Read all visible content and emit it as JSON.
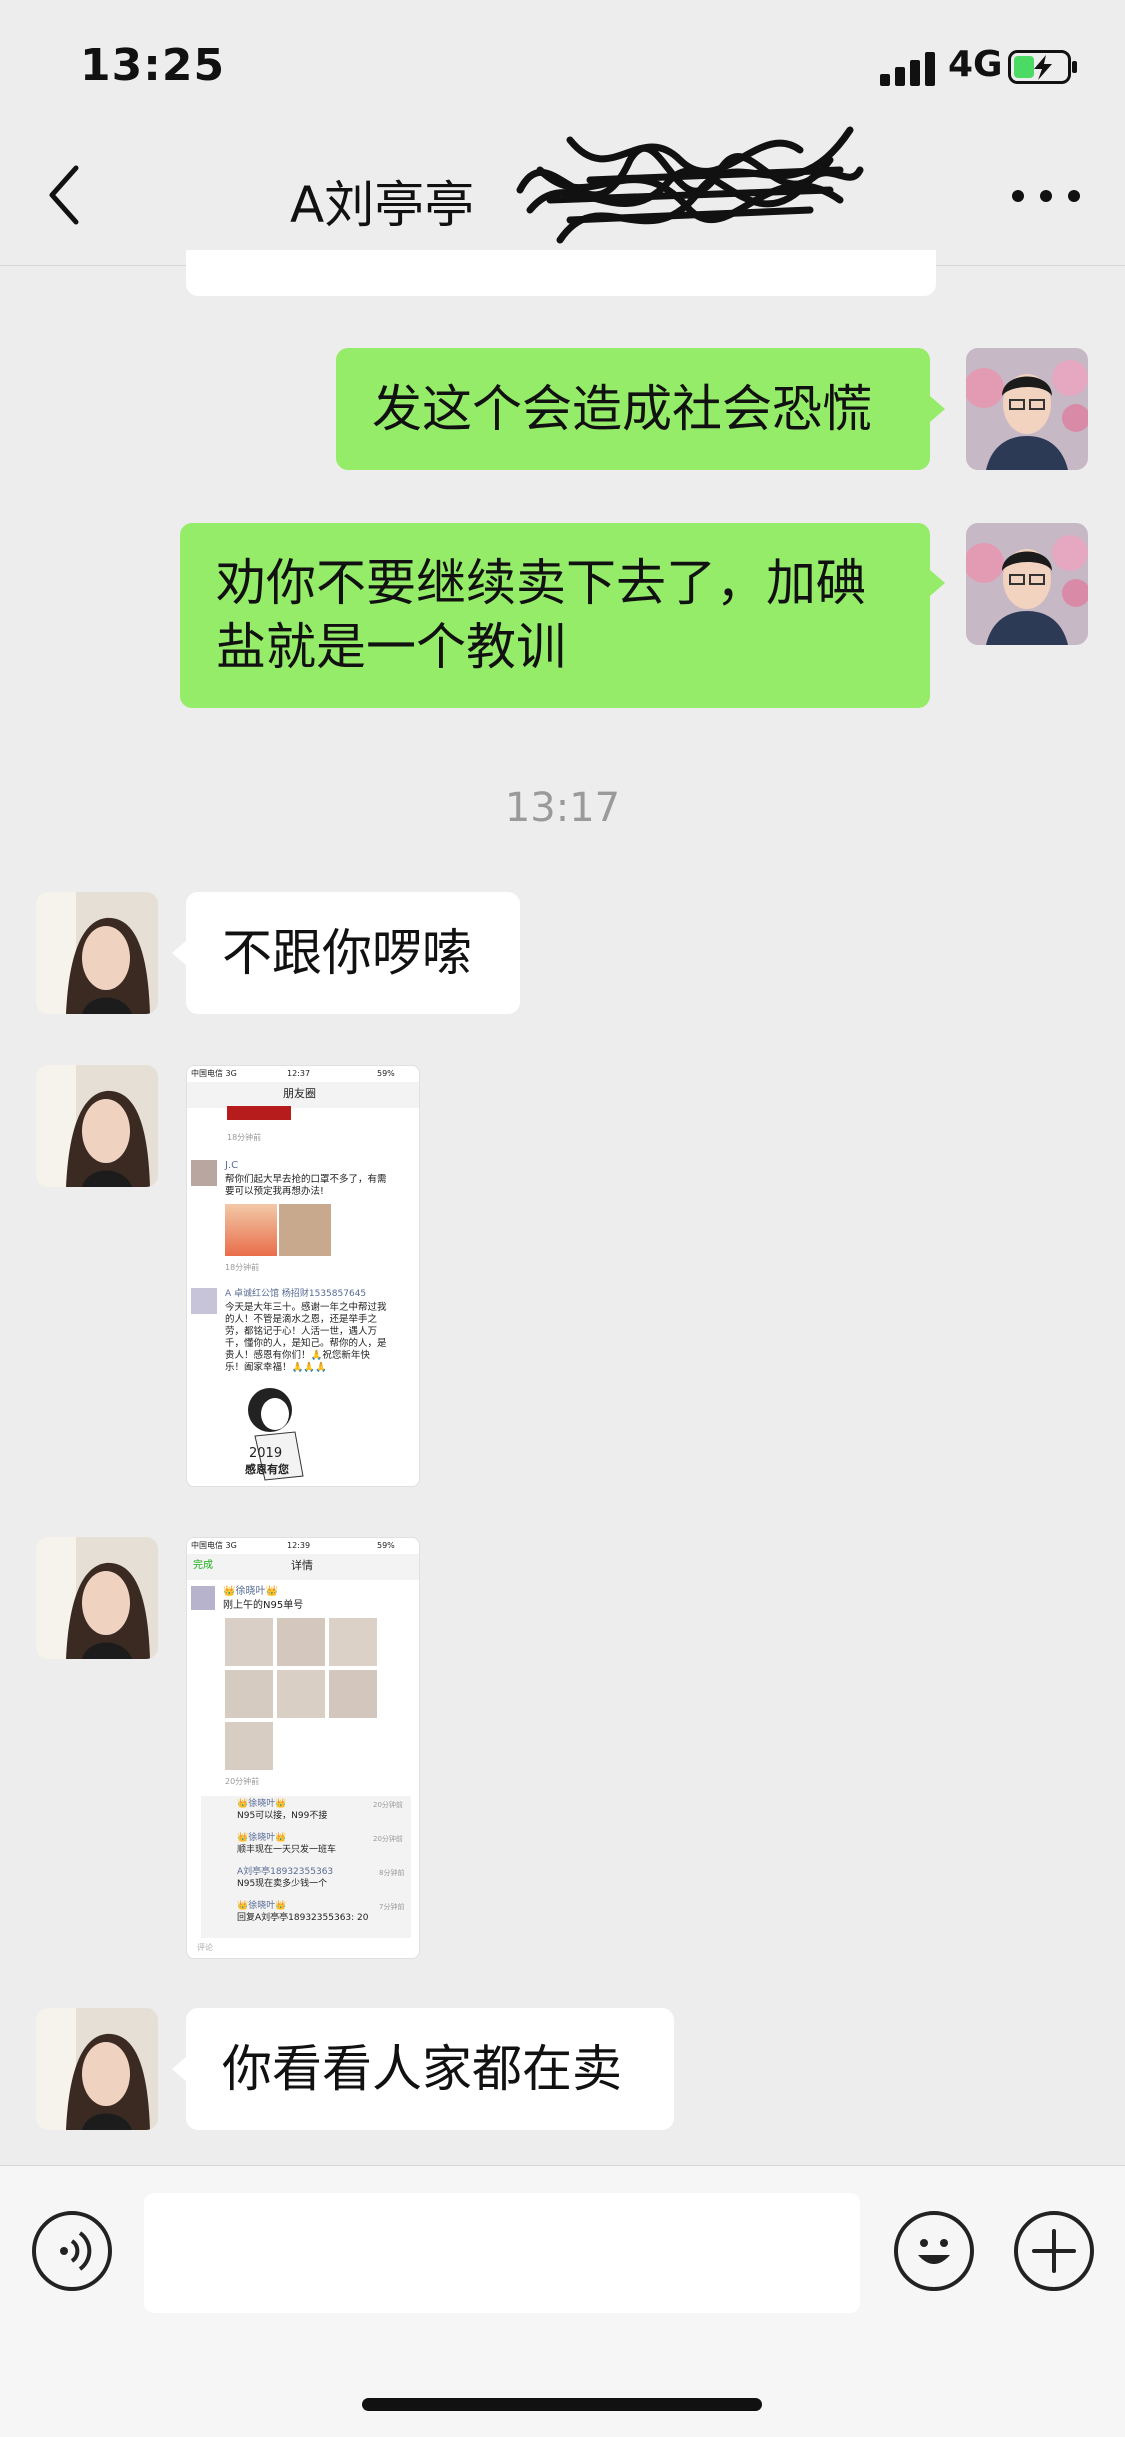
{
  "status_bar": {
    "time": "13:25",
    "network": "4G"
  },
  "header": {
    "title": "A刘亭亭"
  },
  "messages": {
    "m1": "发这个会造成社会恐慌",
    "m2_line1": "劝你不要继续卖下去了，加碘",
    "m2_line2": "盐就是一个教训",
    "timestamp": "13:17",
    "m3": "不跟你啰嗦",
    "m6": "你看看人家都在卖"
  },
  "shot1": {
    "carrier": "中国电信 3G",
    "time": "12:37",
    "battery": "59%",
    "title": "朋友圈",
    "time_ago_top": "18分钟前",
    "post1_name": "J.C",
    "post1_text1": "帮你们起大早去抢的口罩不多了，有需",
    "post1_text2": "要可以预定我再想办法!",
    "post1_time": "18分钟前",
    "post2_name": "A 卓诚红公馆 杨招财15358576​45",
    "post2_l1": "今天是大年三十。感谢一年之中帮过我",
    "post2_l2": "的人！不管是滴水之恩，还是举手之",
    "post2_l3": "劳，都铭记于心！人活一世，遇人万",
    "post2_l4": "千，懂你的人，是知己。帮你的人，是",
    "post2_l5": "贵人！感恩有你们！🙏祝您新年快",
    "post2_l6": "乐！阖家幸福！🙏🙏🙏",
    "card_year": "2019",
    "card_text": "感恩有您"
  },
  "shot2": {
    "carrier": "中国电信 3G",
    "time": "12:39",
    "battery": "59%",
    "done": "完成",
    "title": "详情",
    "poster": "👑徐晓叶👑",
    "post_text": "刚上午的N95单号",
    "time_ago": "20分钟前",
    "c1_name": "👑徐晓叶👑",
    "c1_text": "N95可以接，N99不接",
    "c1_time": "20分钟前",
    "c2_name": "👑徐晓叶👑",
    "c2_text": "顺丰现在一天只发一班车",
    "c2_time": "20分钟前",
    "c3_name": "A刘亭亭18932355363",
    "c3_text": "N95现在卖多少钱一个",
    "c3_time": "8分钟前",
    "c4_name": "👑徐晓叶👑",
    "c4_text": "回复A刘亭亭18932355363: 20",
    "c4_time": "7分钟前",
    "comment_placeholder": "评论"
  },
  "colors": {
    "my_bubble": "#95ec69",
    "their_bubble": "#ffffff",
    "background": "#ededed"
  },
  "icons": [
    "chevron-left-icon",
    "more-icon",
    "voice-icon",
    "emoji-icon",
    "plus-icon"
  ]
}
